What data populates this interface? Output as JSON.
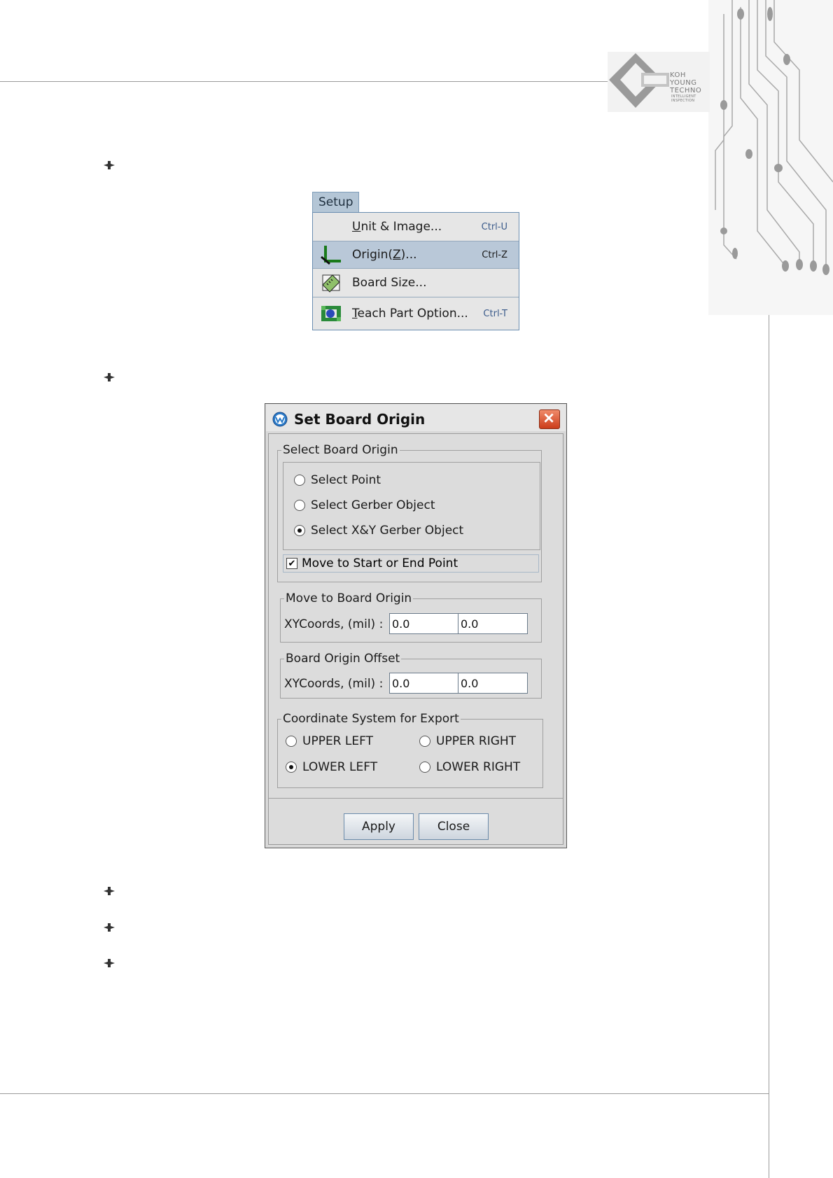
{
  "logo": {
    "line1": "KOH",
    "line2": "YOUNG",
    "line3": "TECHNO",
    "line4": "INTELLIGENT",
    "line5": "INSPECTION"
  },
  "menu": {
    "title": "Setup",
    "items": [
      {
        "pre": "",
        "u": "U",
        "post": "nit & Image...",
        "shortcut": "Ctrl-U",
        "icon": "none"
      },
      {
        "pre": "Origin(",
        "u": "Z",
        "post": ")...",
        "shortcut": "Ctrl-Z",
        "icon": "origin-axes-icon"
      },
      {
        "pre": "Board Size...",
        "u": "",
        "post": "",
        "shortcut": "",
        "icon": "ruler-icon"
      },
      {
        "pre": "",
        "u": "T",
        "post": "each Part Option...",
        "shortcut": "Ctrl-T",
        "icon": "teach-part-icon"
      }
    ]
  },
  "dialog": {
    "title": "Set Board Origin",
    "select_origin": {
      "legend": "Select Board Origin",
      "options": [
        "Select Point",
        "Select Gerber Object",
        "Select X&Y Gerber Object"
      ],
      "selected": 2,
      "checkbox_label": "Move to Start or End Point",
      "checkbox_checked": true
    },
    "move_to_origin": {
      "legend": "Move to Board Origin",
      "label": "XYCoords, (mil) :",
      "x": "0.0",
      "y": "0.0"
    },
    "origin_offset": {
      "legend": "Board Origin Offset",
      "label": "XYCoords, (mil) :",
      "x": "0.0",
      "y": "0.0"
    },
    "coord_system": {
      "legend": "Coordinate System for Export",
      "options": [
        "UPPER LEFT",
        "UPPER RIGHT",
        "LOWER LEFT",
        "LOWER RIGHT"
      ],
      "selected": 2
    },
    "buttons": {
      "apply": "Apply",
      "close": "Close"
    }
  }
}
